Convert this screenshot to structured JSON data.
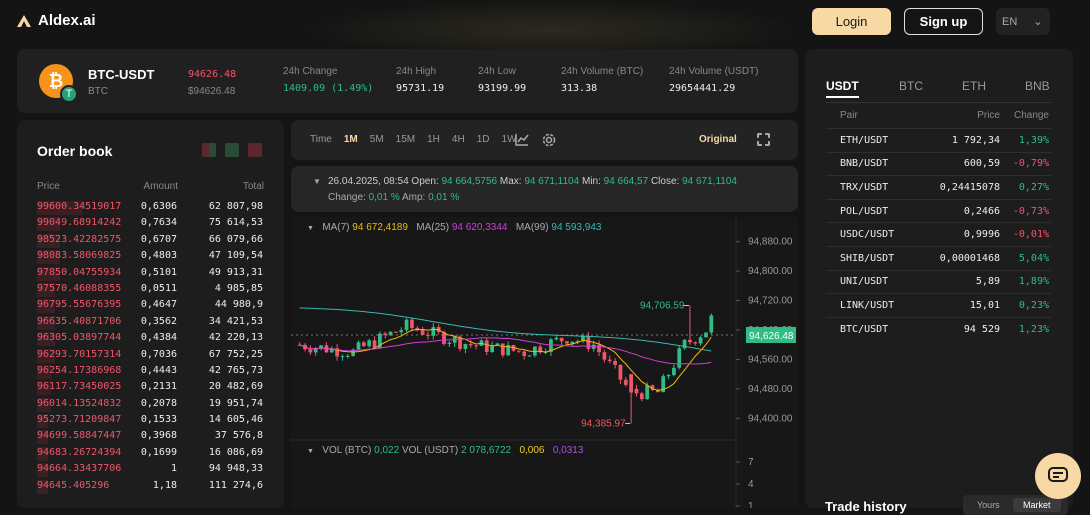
{
  "header": {
    "brand": "Aldex.ai",
    "login": "Login",
    "signup": "Sign up",
    "lang": "EN"
  },
  "ticker": {
    "symbol": "BTC-USDT",
    "base": "BTC",
    "price": "94626.48",
    "price_usd": "$94626.48",
    "stats": [
      {
        "label": "24h Change",
        "value": "1409.09 (1.49%)",
        "color": "green"
      },
      {
        "label": "24h High",
        "value": "95731.19"
      },
      {
        "label": "24h Low",
        "value": "93199.99"
      },
      {
        "label": "24h Volume (BTC)",
        "value": "313.38"
      },
      {
        "label": "24h Volume (USDT)",
        "value": "29654441.29"
      }
    ]
  },
  "orderbook": {
    "title": "Order book",
    "headers": {
      "price": "Price",
      "amount": "Amount",
      "total": "Total"
    },
    "rows": [
      {
        "price": "99600.34519017",
        "amount": "0,6306",
        "total": "62 807,98",
        "depth": 0.2
      },
      {
        "price": "99049.68914242",
        "amount": "0,7634",
        "total": "75 614,53",
        "depth": 0.1
      },
      {
        "price": "98523.42282575",
        "amount": "0,6707",
        "total": "66 079,66",
        "depth": 0.1
      },
      {
        "price": "98083.58069825",
        "amount": "0,4803",
        "total": "47 109,54",
        "depth": 0.1
      },
      {
        "price": "97850.04755934",
        "amount": "0,5101",
        "depth": 0.1,
        "total": "49 913,31"
      },
      {
        "price": "97570.46088355",
        "amount": "0,0511",
        "total": "4 985,85",
        "depth": 0.08
      },
      {
        "price": "96795.55676395",
        "amount": "0,4647",
        "total": "44 980,9",
        "depth": 0.08
      },
      {
        "price": "96635.40871706",
        "amount": "0,3562",
        "total": "34 421,53",
        "depth": 0.08
      },
      {
        "price": "96305.03897744",
        "amount": "0,4384",
        "total": "42 220,13",
        "depth": 0.08
      },
      {
        "price": "96293.70157314",
        "amount": "0,7036",
        "total": "67 752,25",
        "depth": 0.08
      },
      {
        "price": "96254.17386968",
        "amount": "0,4443",
        "total": "42 765,73",
        "depth": 0.06
      },
      {
        "price": "96117.73450025",
        "amount": "0,2131",
        "total": "20 482,69",
        "depth": 0.06
      },
      {
        "price": "96014.13524832",
        "amount": "0,2078",
        "total": "19 951,74",
        "depth": 0.06
      },
      {
        "price": "95273.71209847",
        "amount": "0,1533",
        "total": "14 605,46",
        "depth": 0.05
      },
      {
        "price": "94699.58847447",
        "amount": "0,3968",
        "total": "37 576,8",
        "depth": 0.05
      },
      {
        "price": "94683.26724394",
        "amount": "0,1699",
        "total": "16 086,69",
        "depth": 0.05
      },
      {
        "price": "94664.33437706",
        "amount": "1",
        "total": "94 948,33",
        "depth": 0.05
      },
      {
        "price": "94645.405296",
        "amount": "1,18",
        "total": "111 274,6",
        "depth": 0.05
      }
    ]
  },
  "chart_toolbar": {
    "intervals": [
      "Time",
      "1M",
      "5M",
      "15M",
      "1H",
      "4H",
      "1D",
      "1W"
    ],
    "active": "1M",
    "original": "Original"
  },
  "candle_info": {
    "date": "26.04.2025, 08:54",
    "open_label": "Open:",
    "open": "94 664,5756",
    "max_label": "Max:",
    "max": "94 671,1104",
    "min_label": "Min:",
    "min": "94 664,57",
    "close_label": "Close:",
    "close": "94 671,1104",
    "change_label": "Change:",
    "change": "0,01 %",
    "amp_label": "Amp:",
    "amp": "0,01 %"
  },
  "indicators": {
    "ma7_label": "MA(7)",
    "ma7": "94 672,4189",
    "ma25_label": "MA(25)",
    "ma25": "94 620,3344",
    "ma99_label": "MA(99)",
    "ma99": "94 593,943"
  },
  "volume": {
    "label_btc": "VOL (BTC)",
    "vol_btc": "0,022",
    "label_usdt": "VOL (USDT)",
    "vol_usdt": "2 078,6722",
    "v1": "0,006",
    "v2": "0,0313",
    "ticks": [
      "7",
      "4",
      "1"
    ]
  },
  "chart_data": {
    "type": "candlestick",
    "price_ticks": [
      "94,880.00",
      "94,800.00",
      "94,720.00",
      "94,640.00",
      "94,560.00",
      "94,480.00",
      "94,400.00"
    ],
    "ylim": [
      94360,
      94920
    ],
    "current_price": "94,626.48",
    "current_value": 94626.48,
    "high_label": "94,706.59",
    "high_value": 94706.59,
    "low_label": "94,385.97",
    "low_value": 94385.97,
    "colors": {
      "up": "#2ebd85",
      "down": "#f0566b",
      "ma7": "#f0b90b",
      "ma25": "#d63bd6",
      "ma99": "#37b8b0"
    }
  },
  "markets": {
    "tabs": [
      "USDT",
      "BTC",
      "ETH",
      "BNB"
    ],
    "active": "USDT",
    "headers": {
      "pair": "Pair",
      "price": "Price",
      "change": "Change"
    },
    "rows": [
      {
        "pair": "ETH/USDT",
        "price": "1 792,34",
        "change": "1,39%",
        "dir": "up"
      },
      {
        "pair": "BNB/USDT",
        "price": "600,59",
        "change": "-0,79%",
        "dir": "down"
      },
      {
        "pair": "TRX/USDT",
        "price": "0,24415078",
        "change": "0,27%",
        "dir": "up"
      },
      {
        "pair": "POL/USDT",
        "price": "0,2466",
        "change": "-0,73%",
        "dir": "down"
      },
      {
        "pair": "USDC/USDT",
        "price": "0,9996",
        "change": "-0,01%",
        "dir": "down"
      },
      {
        "pair": "SHIB/USDT",
        "price": "0,00001468",
        "change": "5,04%",
        "dir": "up"
      },
      {
        "pair": "UNI/USDT",
        "price": "5,89",
        "change": "1,89%",
        "dir": "up"
      },
      {
        "pair": "LINK/USDT",
        "price": "15,01",
        "change": "0,23%",
        "dir": "up"
      },
      {
        "pair": "BTC/USDT",
        "price": "94 529",
        "change": "1,23%",
        "dir": "up"
      }
    ]
  },
  "trade_history": {
    "title": "Trade history",
    "tabs": [
      "Yours",
      "Market"
    ],
    "active": "Market"
  }
}
